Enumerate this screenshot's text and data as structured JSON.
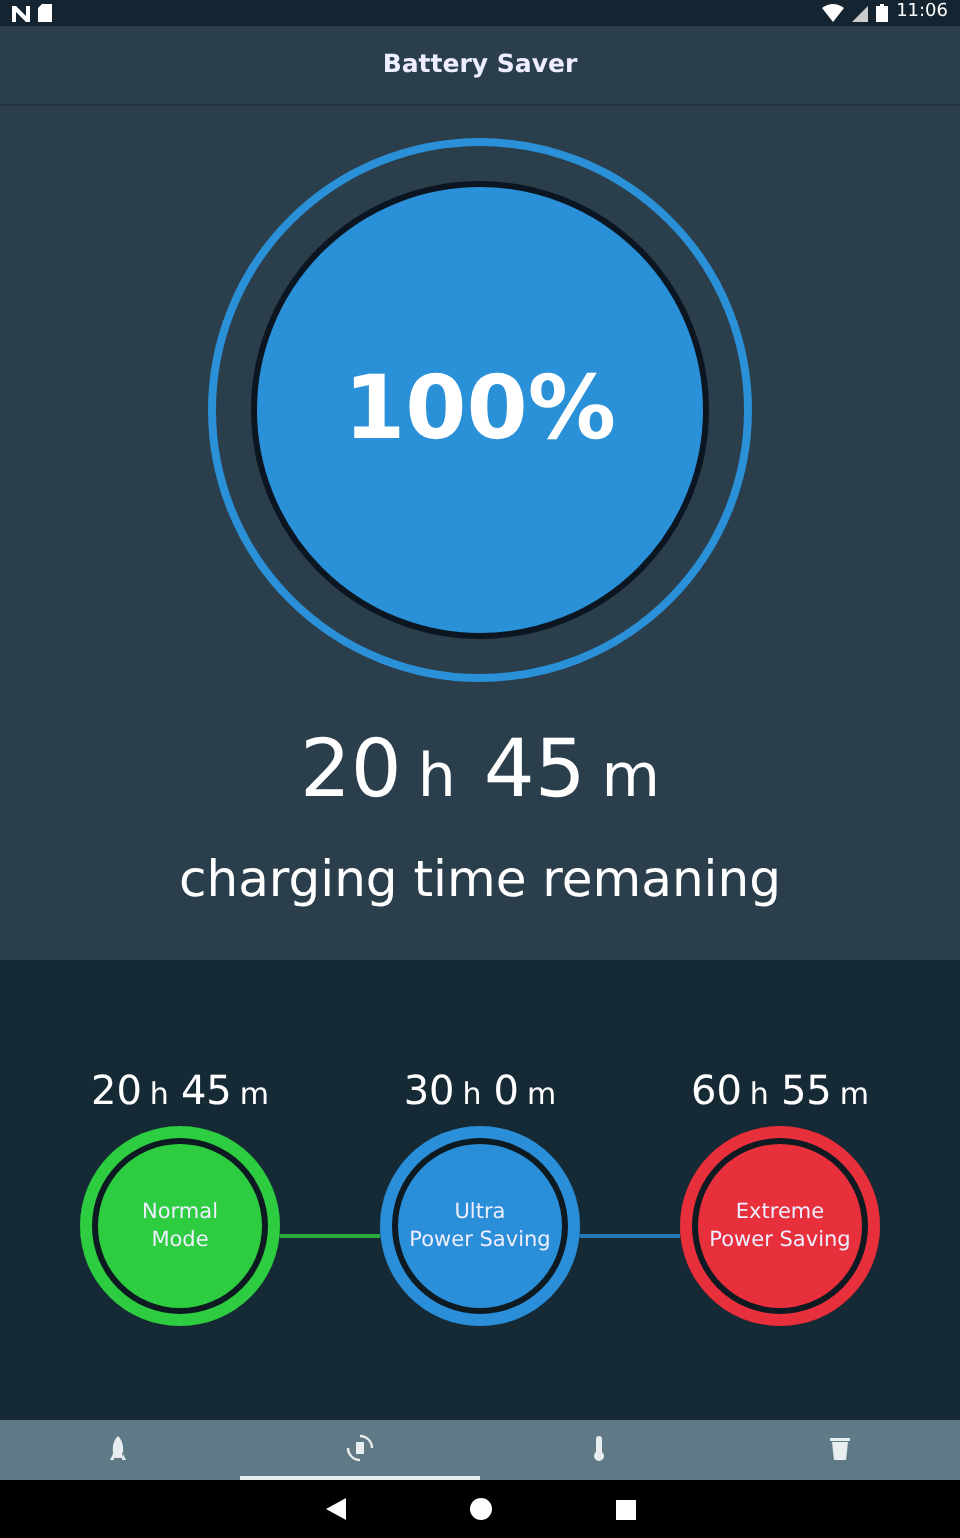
{
  "status_bar": {
    "time": "11:06"
  },
  "app_bar": {
    "title": "Battery Saver"
  },
  "battery": {
    "percent": "100%",
    "time_parts": [
      {
        "value": "20",
        "unit": "h"
      },
      {
        "value": "45",
        "unit": "m"
      }
    ],
    "caption": "charging time remaning"
  },
  "modes": [
    {
      "time_parts": [
        {
          "value": "20",
          "unit": "h"
        },
        {
          "value": "45",
          "unit": "m"
        }
      ],
      "label": [
        "Normal",
        "Mode"
      ],
      "color": "#2ecc40"
    },
    {
      "time_parts": [
        {
          "value": "30",
          "unit": "h"
        },
        {
          "value": "0",
          "unit": "m"
        }
      ],
      "label": [
        "Ultra",
        "Power Saving"
      ],
      "color": "#2a8fd8"
    },
    {
      "time_parts": [
        {
          "value": "60",
          "unit": "h"
        },
        {
          "value": "55",
          "unit": "m"
        }
      ],
      "label": [
        "Extreme",
        "Power Saving"
      ],
      "color": "#e8303c"
    }
  ],
  "tabs": [
    {
      "kind": "rocket",
      "selected": false
    },
    {
      "kind": "recycle",
      "selected": true
    },
    {
      "kind": "thermometer",
      "selected": false
    },
    {
      "kind": "trash",
      "selected": false
    }
  ]
}
